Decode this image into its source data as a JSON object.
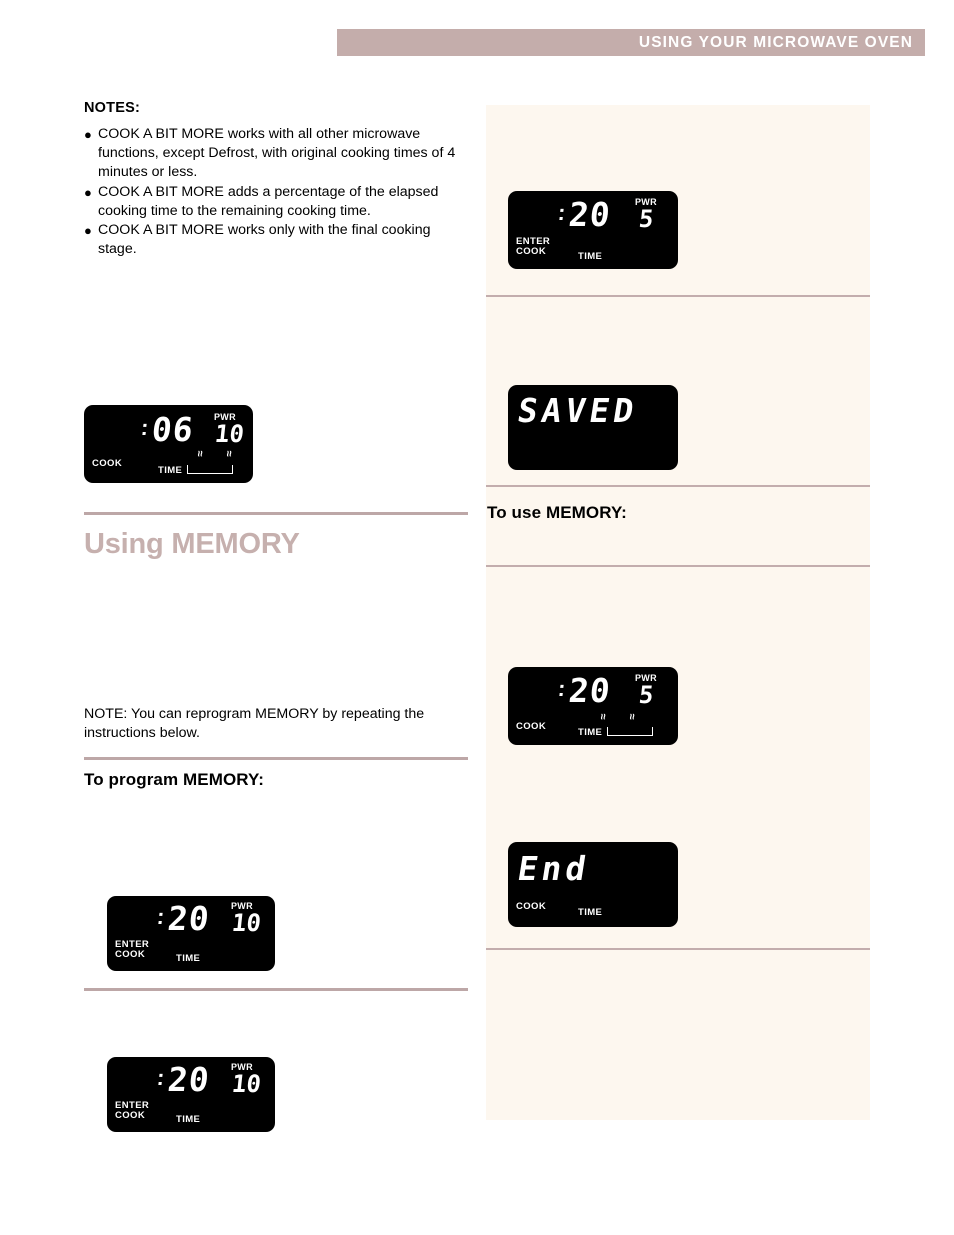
{
  "header": {
    "title": "USING YOUR MICROWAVE OVEN"
  },
  "left": {
    "notes_title": "NOTES:",
    "notes": [
      {
        "indent": "                    ",
        "text": "COOK A BIT MORE works with all other microwave functions, except Defrost, with original cooking times of 4 minutes or less."
      },
      {
        "indent": "                    ",
        "text": "COOK A BIT MORE adds a percentage of the elapsed cooking time to the remaining cooking time."
      },
      {
        "indent": "                              ",
        "text": "COOK A BIT MORE works only with the final cooking stage."
      }
    ],
    "display_cook_06": {
      "time": "06",
      "colon": ":",
      "pwr_label": "PWR",
      "pwr_value": "10",
      "mode_label": "COOK",
      "time_label": "TIME",
      "wave_icon": "wave-icon"
    },
    "heading_using_memory": "Using MEMORY",
    "note_reprogram": "NOTE: You can reprogram MEMORY by repeating the instructions below.",
    "heading_to_program": "To program MEMORY:",
    "display_enter_cook_20_a": {
      "time": "20",
      "colon": ":",
      "pwr_label": "PWR",
      "pwr_value": "10",
      "mode_label_line1": "ENTER",
      "mode_label_line2": "COOK",
      "time_label": "TIME"
    },
    "display_enter_cook_20_b": {
      "time": "20",
      "colon": ":",
      "pwr_label": "PWR",
      "pwr_value": "10",
      "mode_label_line1": "ENTER",
      "mode_label_line2": "COOK",
      "time_label": "TIME"
    }
  },
  "right": {
    "display_enter_cook_20_pwr5": {
      "time": "20",
      "colon": ":",
      "pwr_label": "PWR",
      "pwr_value": "5",
      "mode_label_line1": "ENTER",
      "mode_label_line2": "COOK",
      "time_label": "TIME"
    },
    "display_saved": {
      "word": "SAVED"
    },
    "heading_to_use": "To use MEMORY:",
    "display_cook_20_pwr5": {
      "time": "20",
      "colon": ":",
      "pwr_label": "PWR",
      "pwr_value": "5",
      "mode_label": "COOK",
      "time_label": "TIME",
      "wave_icon": "wave-icon"
    },
    "display_end": {
      "word": "End",
      "mode_label": "COOK",
      "time_label": "TIME"
    }
  },
  "colors": {
    "header_bar": "#c4adab",
    "heading_accent": "#c6b0ae",
    "rule": "#bda7a7",
    "panel_bg": "#fdf7ef",
    "lcd_bg": "#000000",
    "lcd_fg": "#ffffff"
  }
}
